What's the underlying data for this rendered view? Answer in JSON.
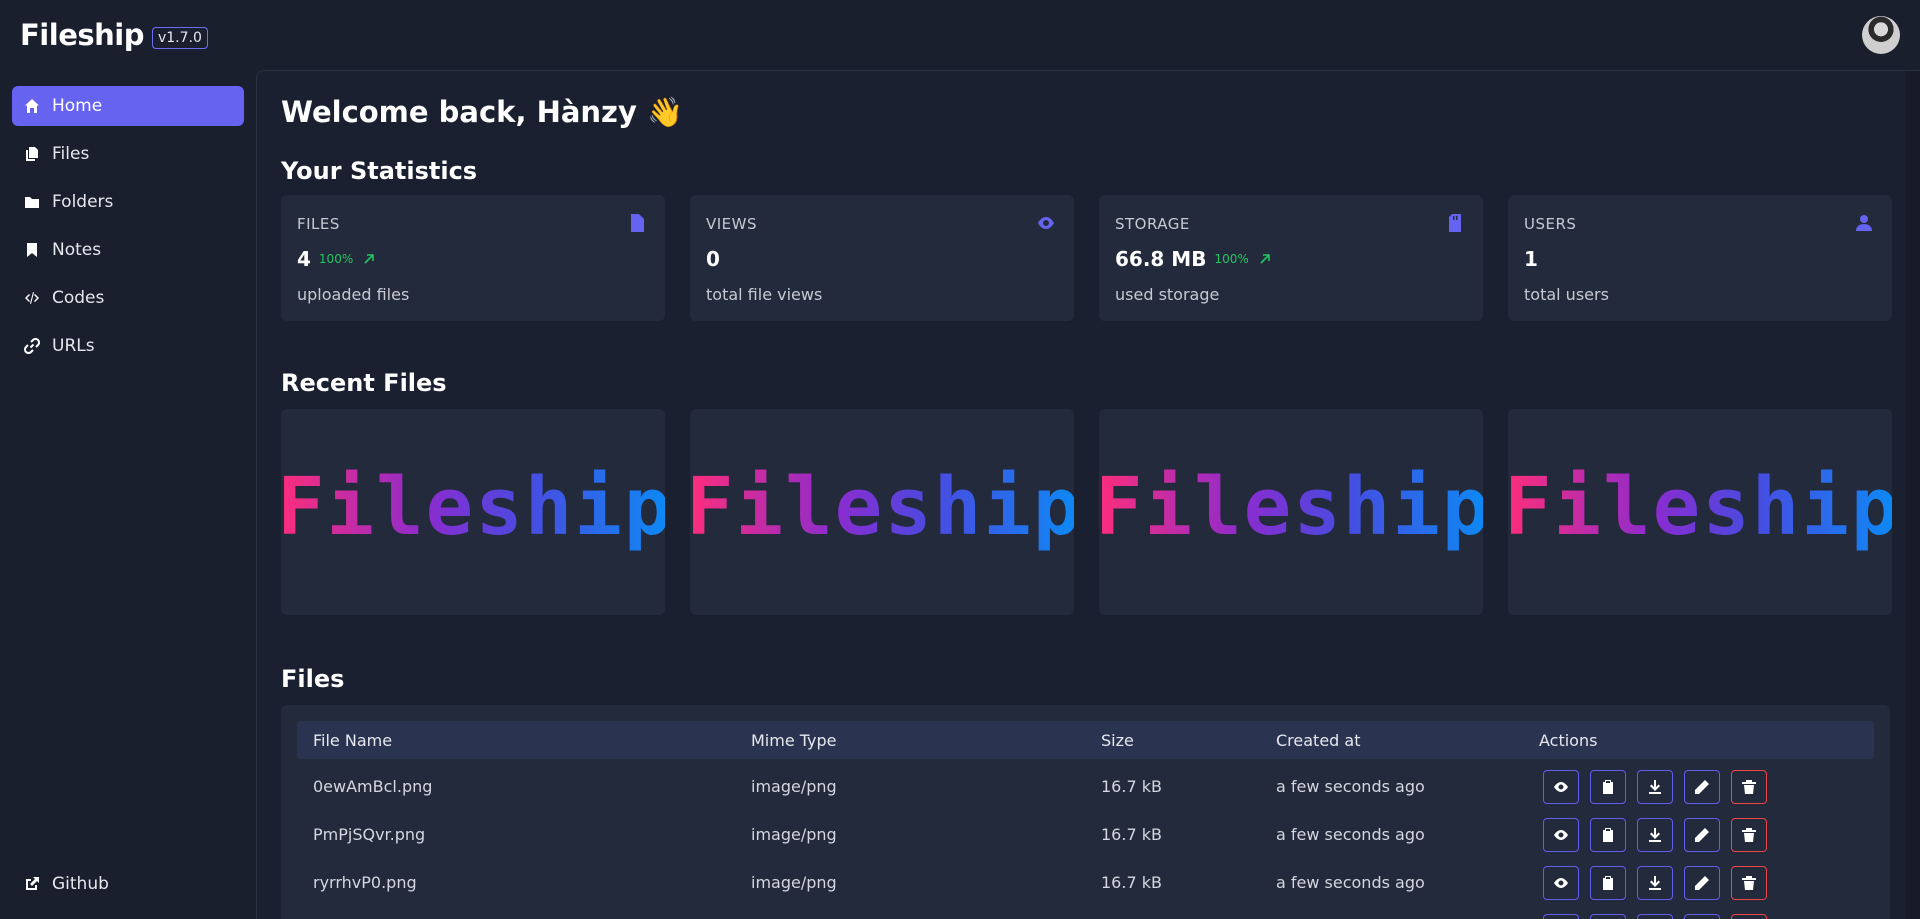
{
  "app": {
    "name": "Fileship",
    "version": "v1.7.0"
  },
  "nav": {
    "items": [
      {
        "label": "Home",
        "icon": "home-icon"
      },
      {
        "label": "Files",
        "icon": "files-icon"
      },
      {
        "label": "Folders",
        "icon": "folder-icon"
      },
      {
        "label": "Notes",
        "icon": "bookmark-icon"
      },
      {
        "label": "Codes",
        "icon": "code-icon"
      },
      {
        "label": "URLs",
        "icon": "link-icon"
      }
    ],
    "github": "Github"
  },
  "main": {
    "welcome": "Welcome back, Hànzy 👋",
    "stats_title": "Your Statistics",
    "stats": [
      {
        "label": "FILES",
        "value": "4",
        "trend": "100%",
        "sub": "uploaded files",
        "icon": "file-icon"
      },
      {
        "label": "VIEWS",
        "value": "0",
        "trend": "",
        "sub": "total file views",
        "icon": "eye-icon"
      },
      {
        "label": "STORAGE",
        "value": "66.8 MB",
        "trend": "100%",
        "sub": "used storage",
        "icon": "sd-card-icon"
      },
      {
        "label": "USERS",
        "value": "1",
        "trend": "",
        "sub": "total users",
        "icon": "user-icon"
      }
    ],
    "recent_title": "Recent Files",
    "recent_files": [
      {
        "preview_text": "Fileship"
      },
      {
        "preview_text": "Fileship"
      },
      {
        "preview_text": "Fileship"
      },
      {
        "preview_text": "Fileship"
      }
    ],
    "files_title": "Files",
    "table": {
      "headers": [
        "File Name",
        "Mime Type",
        "Size",
        "Created at",
        "Actions"
      ],
      "rows": [
        {
          "name": "0ewAmBcl.png",
          "mime": "image/png",
          "size": "16.7 kB",
          "created": "a few seconds ago"
        },
        {
          "name": "PmPjSQvr.png",
          "mime": "image/png",
          "size": "16.7 kB",
          "created": "a few seconds ago"
        },
        {
          "name": "ryrrhvP0.png",
          "mime": "image/png",
          "size": "16.7 kB",
          "created": "a few seconds ago"
        },
        {
          "name": "",
          "mime": "",
          "size": "",
          "created": ""
        }
      ]
    }
  },
  "colors": {
    "accent": "#6563f0",
    "danger": "#ef4444",
    "success": "#22c55e",
    "bg": "#1a1f2e",
    "card": "#232a3b"
  }
}
